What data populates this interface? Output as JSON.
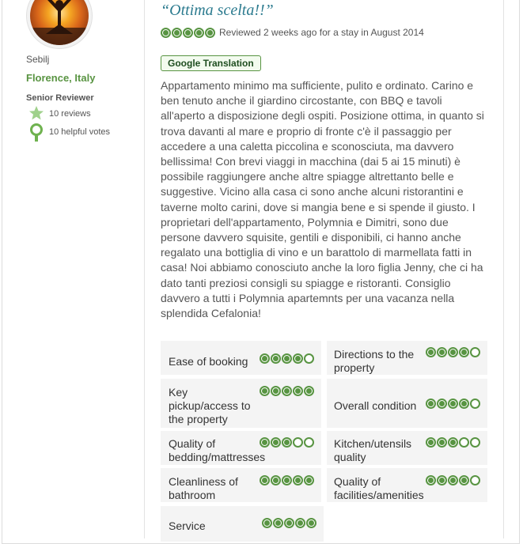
{
  "review": {
    "title": "“Ottima scelta!!”",
    "rating": 5,
    "rating_text": "Reviewed 2 weeks ago for a stay in August 2014",
    "translate_button": "Google Translation",
    "body": "Appartamento minimo ma sufficiente, pulito e ordinato. Carino e ben tenuto anche il giardino circostante, con BBQ e tavoli all'aperto a disposizione degli ospiti. Posizione ottima, in quanto si trova davanti al mare e proprio di fronte c'è il passaggio per accedere a una caletta piccolina e sconosciuta, ma davvero bellissima! Con brevi viaggi in macchina (dai 5 ai 15 minuti) è possibile raggiungere anche altre spiagge altrettanto belle e suggestive. Vicino alla casa ci sono anche alcuni ristorantini e taverne molto carini, dove si mangia bene e si spende il giusto. I proprietari dell'appartamento, Polymnia e Dimitri, sono due persone davvero squisite, gentili e disponibili, ci hanno anche regalato una bottiglia di vino e un barattolo di marmellata fatti in casa! Noi abbiamo conosciuto anche la loro figlia Jenny, che ci ha dato tanti preziosi consigli su spiagge e ristoranti. Consiglio davvero a tutti i Polymnia apartemnts per una vacanza nella splendida Cefalonia!"
  },
  "reviewer": {
    "name": "Sebilj",
    "location": "Florence, Italy",
    "badge": "Senior Reviewer",
    "reviews": "10 reviews",
    "helpful_votes": "10 helpful votes"
  },
  "sub_ratings": [
    {
      "label": "Ease of booking",
      "rating": 4
    },
    {
      "label": "Directions to the property",
      "rating": 4
    },
    {
      "label": "Key pickup/access to the property",
      "rating": 5
    },
    {
      "label": "Overall condition",
      "rating": 4
    },
    {
      "label": "Quality of bedding/mattresses",
      "rating": 3
    },
    {
      "label": "Kitchen/utensils quality",
      "rating": 3
    },
    {
      "label": "Cleanliness of bathroom",
      "rating": 5
    },
    {
      "label": "Quality of facilities/amenities",
      "rating": 4
    },
    {
      "label": "Service",
      "rating": 5
    }
  ],
  "colors": {
    "accent_green": "#589442",
    "title_teal": "#2c7b8f"
  },
  "icons": {
    "reviews": "star-icon",
    "helpful": "ribbon-icon"
  }
}
